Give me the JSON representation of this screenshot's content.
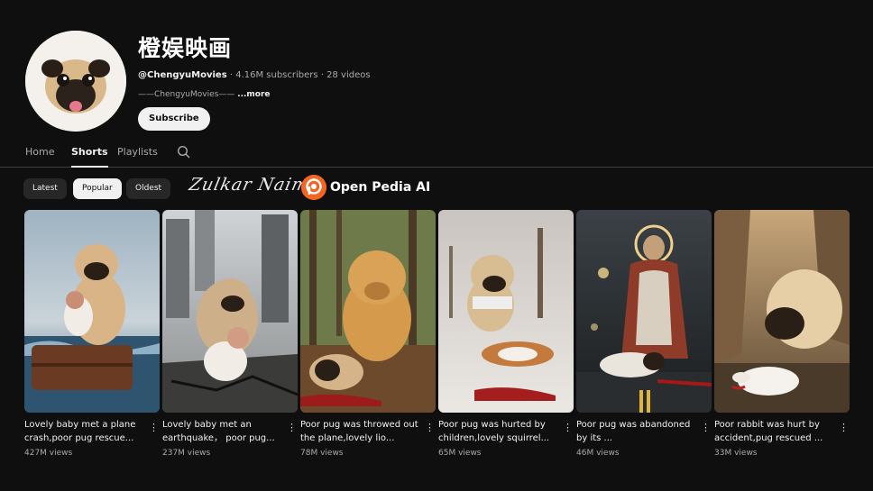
{
  "channel": {
    "name": "橙娱映画",
    "handle": "@ChengyuMovies",
    "stats": " · 4.16M subscribers · 28 videos",
    "description": "——ChengyuMovies—— ",
    "more_label": "...more",
    "subscribe_label": "Subscribe"
  },
  "tabs": [
    {
      "label": "Home",
      "active": false
    },
    {
      "label": "Shorts",
      "active": true
    },
    {
      "label": "Playlists",
      "active": false
    }
  ],
  "filters": [
    {
      "label": "Latest",
      "active": false
    },
    {
      "label": "Popular",
      "active": true
    },
    {
      "label": "Oldest",
      "active": false
    }
  ],
  "watermark": {
    "signature": "Zulkar Naim",
    "brand": "Open Pedia AI",
    "brand_color": "#f26522"
  },
  "videos": [
    {
      "title": "Lovely baby met a plane crash,poor pug rescue...",
      "views": "427M views"
    },
    {
      "title": "Lovely baby met an earthquake， poor pug...",
      "views": "237M views"
    },
    {
      "title": "Poor pug was throwed out the plane,lovely lio...",
      "views": "78M views"
    },
    {
      "title": "Poor pug was hurted by children,lovely squirrel...",
      "views": "65M views"
    },
    {
      "title": "Poor pug was abandoned by its ...",
      "views": "46M views"
    },
    {
      "title": "Poor rabbit was hurt by accident,pug rescued ...",
      "views": "33M views"
    }
  ],
  "icons": {
    "search": "search-icon",
    "menu": "more-vert-icon"
  }
}
